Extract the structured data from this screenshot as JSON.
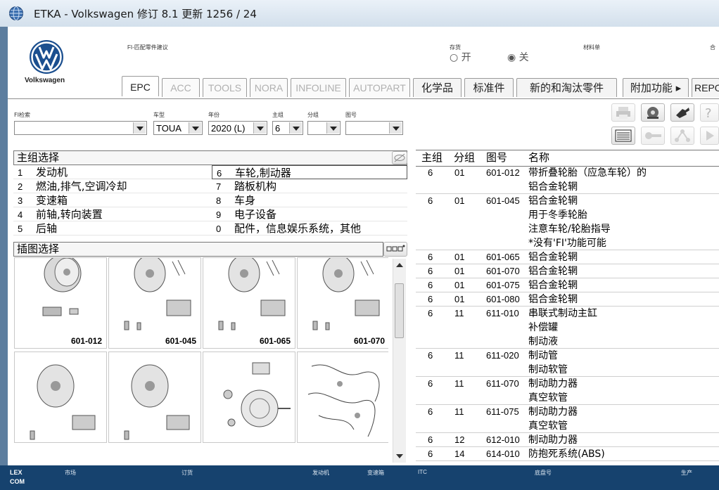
{
  "window": {
    "title": "ETKA - Volkswagen 修订 8.1 更新 1256 / 24"
  },
  "header": {
    "brand": "Volkswagen",
    "fi_label": "FI-匹配零件建议",
    "stock_label": "存货",
    "radio_on": "开",
    "radio_off": "关",
    "materials_label": "材料单",
    "right_label": "合"
  },
  "tabs": [
    {
      "label": "EPC",
      "state": "active"
    },
    {
      "label": "ACC",
      "state": "disabled"
    },
    {
      "label": "TOOLS",
      "state": "disabled"
    },
    {
      "label": "NORA",
      "state": "disabled"
    },
    {
      "label": "INFOLINE",
      "state": "disabled"
    },
    {
      "label": "AUTOPART",
      "state": "disabled"
    },
    {
      "label": "化学品",
      "state": "normal"
    },
    {
      "label": "标准件",
      "state": "normal"
    },
    {
      "label": "新的和淘汰零件",
      "state": "normal"
    },
    {
      "label": "附加功能 ▸",
      "state": "normal"
    },
    {
      "label": "REPO",
      "state": "normal"
    }
  ],
  "filters": {
    "fi_search_label": "FI检索",
    "fi_search_value": "",
    "model_label": "车型",
    "model_value": "TOUA",
    "year_label": "年份",
    "year_value": "2020 (L)",
    "main_group_label": "主组",
    "main_group_value": "6",
    "sub_group_label": "分组",
    "sub_group_value": "",
    "figure_label": "图号",
    "figure_value": ""
  },
  "main_groups": {
    "title": "主组选择",
    "items": [
      {
        "num": "1",
        "name": "发动机"
      },
      {
        "num": "2",
        "name": "燃油,排气,空调冷却"
      },
      {
        "num": "3",
        "name": "变速箱"
      },
      {
        "num": "4",
        "name": "前轴,转向装置"
      },
      {
        "num": "5",
        "name": "后轴"
      },
      {
        "num": "6",
        "name": "车轮,制动器"
      },
      {
        "num": "7",
        "name": "踏板机构"
      },
      {
        "num": "8",
        "name": "车身"
      },
      {
        "num": "9",
        "name": "电子设备"
      },
      {
        "num": "0",
        "name": "配件，信息娱乐系统，其他"
      }
    ],
    "selected": "6"
  },
  "illustrations": {
    "title": "插图选择",
    "items": [
      "601-012",
      "601-045",
      "601-065",
      "601-070",
      "",
      "",
      "",
      ""
    ]
  },
  "parts": {
    "headers": {
      "main": "主组",
      "sub": "分组",
      "fig": "图号",
      "name": "名称"
    },
    "rows": [
      {
        "main": "6",
        "sub": "01",
        "fig": "601-012",
        "lines": [
          "带折叠轮胎（应急车轮）的",
          "铝合金轮辋"
        ]
      },
      {
        "main": "6",
        "sub": "01",
        "fig": "601-045",
        "lines": [
          "铝合金轮辋",
          "用于冬季轮胎",
          "注意车轮/轮胎指导",
          "*没有'FI'功能可能"
        ]
      },
      {
        "main": "6",
        "sub": "01",
        "fig": "601-065",
        "lines": [
          "铝合金轮辋"
        ]
      },
      {
        "main": "6",
        "sub": "01",
        "fig": "601-070",
        "lines": [
          "铝合金轮辋"
        ]
      },
      {
        "main": "6",
        "sub": "01",
        "fig": "601-075",
        "lines": [
          "铝合金轮辋"
        ]
      },
      {
        "main": "6",
        "sub": "01",
        "fig": "601-080",
        "lines": [
          "铝合金轮辋"
        ]
      },
      {
        "main": "6",
        "sub": "11",
        "fig": "611-010",
        "lines": [
          "串联式制动主缸",
          "补偿罐",
          "制动液"
        ]
      },
      {
        "main": "6",
        "sub": "11",
        "fig": "611-020",
        "lines": [
          "制动管",
          "制动软管"
        ]
      },
      {
        "main": "6",
        "sub": "11",
        "fig": "611-070",
        "lines": [
          "制动助力器",
          "真空软管"
        ]
      },
      {
        "main": "6",
        "sub": "11",
        "fig": "611-075",
        "lines": [
          "制动助力器",
          "真空软管"
        ]
      },
      {
        "main": "6",
        "sub": "12",
        "fig": "612-010",
        "lines": [
          "制动助力器"
        ]
      },
      {
        "main": "6",
        "sub": "14",
        "fig": "614-010",
        "lines": [
          "防抱死系统(ABS)"
        ]
      }
    ]
  },
  "statusbar": {
    "logo_line1": "LEX",
    "logo_line2": "COM",
    "items": [
      "市场",
      "订货",
      "发动机",
      "变速箱",
      "ITC",
      "底盘号",
      "生产"
    ]
  },
  "colors": {
    "statusbar": "#16426e",
    "frame": "#5d7e9f"
  }
}
